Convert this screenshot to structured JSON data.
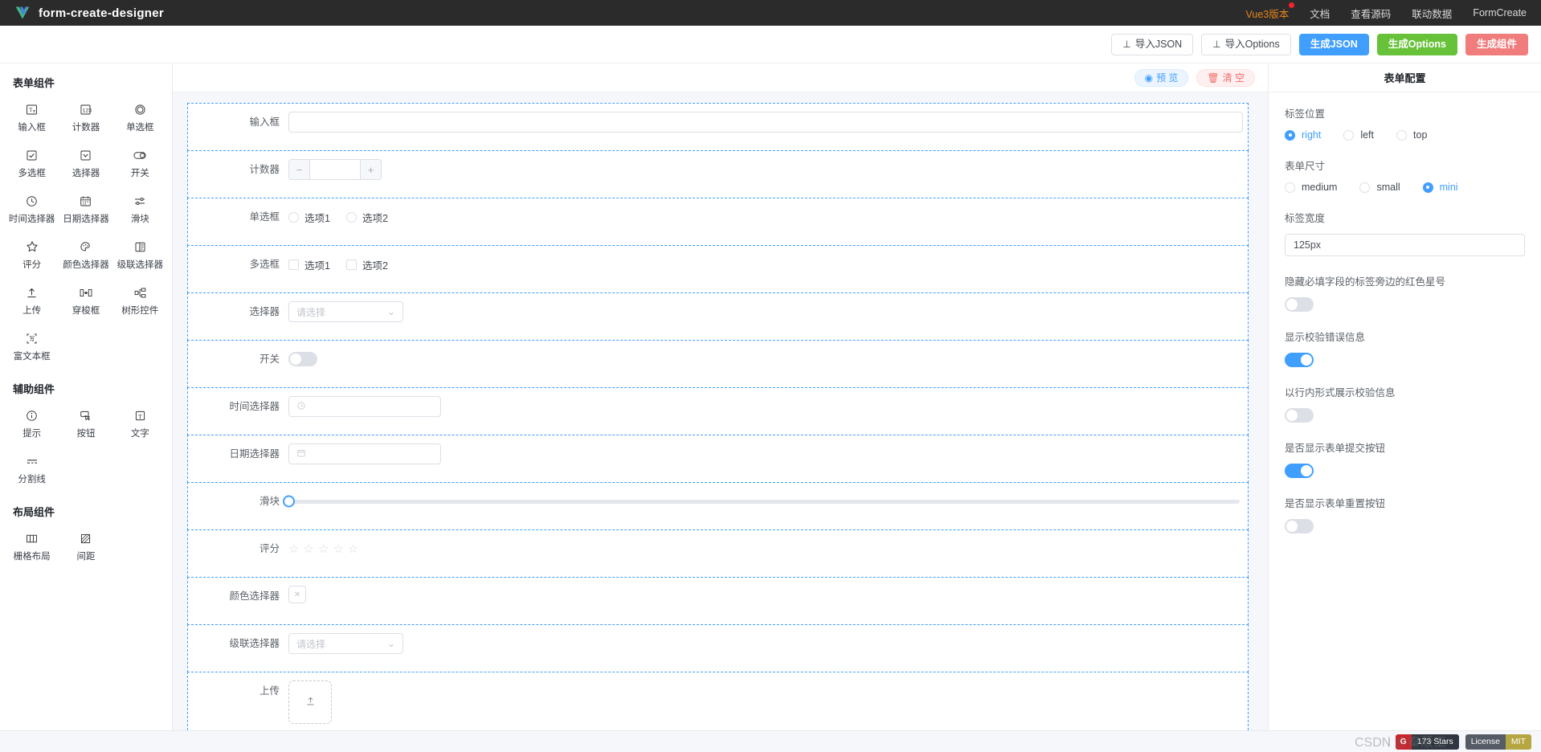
{
  "header": {
    "brand": "form-create-designer",
    "logo_icon": "vue-logo-icon",
    "nav": [
      {
        "label": "Vue3版本",
        "accent": true,
        "badge": true
      },
      {
        "label": "文档",
        "accent": false,
        "badge": false
      },
      {
        "label": "查看源码",
        "accent": false,
        "badge": false
      },
      {
        "label": "联动数据",
        "accent": false,
        "badge": false
      },
      {
        "label": "FormCreate",
        "accent": false,
        "badge": false
      }
    ]
  },
  "toolbar": {
    "import_json": "导入JSON",
    "import_options": "导入Options",
    "gen_json": "生成JSON",
    "gen_options": "生成Options",
    "gen_component": "生成组件",
    "upload_icon": "⊥"
  },
  "sidebar": {
    "groups": [
      {
        "title": "表单组件",
        "items": [
          {
            "label": "输入框",
            "icon": "text-input-icon"
          },
          {
            "label": "计数器",
            "icon": "number-counter-icon"
          },
          {
            "label": "单选框",
            "icon": "radio-icon"
          },
          {
            "label": "多选框",
            "icon": "checkbox-icon"
          },
          {
            "label": "选择器",
            "icon": "select-icon"
          },
          {
            "label": "开关",
            "icon": "switch-icon"
          },
          {
            "label": "时间选择器",
            "icon": "clock-icon"
          },
          {
            "label": "日期选择器",
            "icon": "calendar-icon"
          },
          {
            "label": "滑块",
            "icon": "slider-icon"
          },
          {
            "label": "评分",
            "icon": "star-icon"
          },
          {
            "label": "颜色选择器",
            "icon": "palette-icon"
          },
          {
            "label": "级联选择器",
            "icon": "cascader-icon"
          },
          {
            "label": "上传",
            "icon": "upload-icon"
          },
          {
            "label": "穿梭框",
            "icon": "transfer-icon"
          },
          {
            "label": "树形控件",
            "icon": "tree-icon"
          },
          {
            "label": "富文本框",
            "icon": "rich-text-icon"
          }
        ]
      },
      {
        "title": "辅助组件",
        "items": [
          {
            "label": "提示",
            "icon": "info-icon"
          },
          {
            "label": "按钮",
            "icon": "button-icon"
          },
          {
            "label": "文字",
            "icon": "text-icon"
          },
          {
            "label": "分割线",
            "icon": "divider-icon"
          }
        ]
      },
      {
        "title": "布局组件",
        "items": [
          {
            "label": "栅格布局",
            "icon": "grid-layout-icon"
          },
          {
            "label": "间距",
            "icon": "spacing-icon"
          }
        ]
      }
    ]
  },
  "canvas": {
    "preview_label": "预 览",
    "preview_icon": "eye-icon",
    "clear_label": "清 空",
    "clear_icon": "trash-icon",
    "rows": [
      {
        "label": "输入框",
        "type": "input",
        "placeholder": ""
      },
      {
        "label": "计数器",
        "type": "stepper",
        "minus": "−",
        "plus": "+"
      },
      {
        "label": "单选框",
        "type": "radio",
        "options": [
          "选项1",
          "选项2"
        ]
      },
      {
        "label": "多选框",
        "type": "checkbox",
        "options": [
          "选项1",
          "选项2"
        ]
      },
      {
        "label": "选择器",
        "type": "select",
        "placeholder": "请选择"
      },
      {
        "label": "开关",
        "type": "switch",
        "on": false
      },
      {
        "label": "时间选择器",
        "type": "time",
        "placeholder": "",
        "icon": "clock-icon"
      },
      {
        "label": "日期选择器",
        "type": "date",
        "placeholder": "",
        "icon": "calendar-icon"
      },
      {
        "label": "滑块",
        "type": "slider",
        "value": 0
      },
      {
        "label": "评分",
        "type": "rate",
        "stars": 5,
        "value": 0
      },
      {
        "label": "颜色选择器",
        "type": "color",
        "value": ""
      },
      {
        "label": "级联选择器",
        "type": "cascader",
        "placeholder": "请选择"
      },
      {
        "label": "上传",
        "type": "upload",
        "icon": "upload-icon"
      }
    ]
  },
  "config": {
    "title": "表单配置",
    "label_position": {
      "label": "标签位置",
      "options": [
        {
          "value": "right",
          "checked": true
        },
        {
          "value": "left",
          "checked": false
        },
        {
          "value": "top",
          "checked": false
        }
      ]
    },
    "form_size": {
      "label": "表单尺寸",
      "options": [
        {
          "value": "medium",
          "checked": false
        },
        {
          "value": "small",
          "checked": false
        },
        {
          "value": "mini",
          "checked": true
        }
      ]
    },
    "label_width": {
      "label": "标签宽度",
      "value": "125px"
    },
    "switches": [
      {
        "label": "隐藏必填字段的标签旁边的红色星号",
        "on": false
      },
      {
        "label": "显示校验错误信息",
        "on": true
      },
      {
        "label": "以行内形式展示校验信息",
        "on": false
      },
      {
        "label": "是否显示表单提交按钮",
        "on": true
      },
      {
        "label": "是否显示表单重置按钮",
        "on": false
      }
    ]
  },
  "statusbar": {
    "stars_badge": {
      "icon": "github-icon",
      "text": "173 Stars"
    },
    "license_badge": {
      "left": "License",
      "right": "MIT"
    },
    "watermark": "CSDN @秦蔽工"
  },
  "colors": {
    "header_bg": "#2b2b2b",
    "accent_orange": "#e8841a",
    "primary_blue": "#409eff",
    "success_green": "#67c23a",
    "danger_red": "#f17c7c",
    "canvas_bg": "#f5f7fa"
  }
}
